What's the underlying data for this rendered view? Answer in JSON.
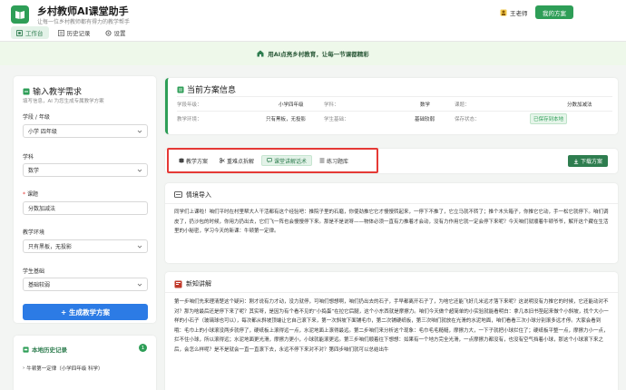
{
  "header": {
    "app_title": "乡村教师AI课堂助手",
    "app_subtitle": "让每一位乡村教师都有得力的教学帮手",
    "nav": [
      {
        "label": "工作台",
        "icon": "home-icon",
        "active": true
      },
      {
        "label": "历史记录",
        "icon": "history-icon",
        "active": false
      },
      {
        "label": "设置",
        "icon": "gear-icon",
        "active": false
      }
    ],
    "user_name": "王老师",
    "my_plan_button": "我的方案"
  },
  "banner": {
    "text": "用AI点亮乡村教育，让每一节课都精彩"
  },
  "left_panel": {
    "title": "输入教学需求",
    "subtitle": "填写信息，AI 为您生成专属教学方案",
    "fields": [
      {
        "label": "学段 / 年级",
        "value": "小学 四年级",
        "required": false
      },
      {
        "label": "学科",
        "value": "数学",
        "required": false
      },
      {
        "label": "课题",
        "value": "分数加减法",
        "required": true
      },
      {
        "label": "教学环境",
        "value": "只有黑板，无投影",
        "required": false
      },
      {
        "label": "学生基础",
        "value": "基础较弱",
        "required": false
      }
    ],
    "generate_button": "+ 生成教学方案"
  },
  "history": {
    "title": "本地历史记录",
    "count": "1",
    "items": [
      "牛顿第一定律（小学四年级 科学）"
    ]
  },
  "plan_info": {
    "title": "当前方案信息",
    "rows": [
      [
        {
          "k": "学段年级：",
          "v": "小学四年级"
        },
        {
          "k": "学科：",
          "v": "数学"
        },
        {
          "k": "课题：",
          "v": "分数加减法"
        }
      ],
      [
        {
          "k": "教学环境：",
          "v": "只有黑板，无投影"
        },
        {
          "k": "学生基础：",
          "v": "基础较弱"
        },
        {
          "k": "保存状态：",
          "v": "已保存到本地"
        }
      ]
    ]
  },
  "tabs": [
    {
      "label": "教学方案",
      "icon": "plan-icon",
      "active": false
    },
    {
      "label": "重难点拆解",
      "icon": "scissors-icon",
      "active": false
    },
    {
      "label": "课堂讲解话术",
      "icon": "speech-icon",
      "active": true
    },
    {
      "label": "练习题库",
      "icon": "list-icon",
      "active": false
    }
  ],
  "download_button": "下载方案",
  "sections": {
    "intro": {
      "title": "情境导入",
      "body": "同学们上课啦！咱们平时在村里帮大人干活都有这个经验吧：推院子里的石磨，你使劲推它它才慢慢转起来，一停下不推了，它立马就不转了；推个木头箱子，你推它它动，手一松它就停下。咱们调皮了，扔沙包的时候，你用力扔出去，它们飞一阵也会慢慢停下来。那是不是说呀——物体必须一直有力推着才会动，没有力作用它就一定会停下来呢？今天咱们就顺着牛顿爷爷，解开这个藏在生活里的小秘密，学习今天的新课：牛顿第一定律。"
    },
    "new": {
      "title": "新知讲解",
      "body": "第一步咱们先来理清楚这个疑问：刚才说有力才动，没力就停，可咱们想想啊，咱们扔出去的石子，手早都离开石子了，为啥它还能飞好几米远才落下来呢？这说明没有力推它的时候，它还能动对不对？那为啥最后还是停下来了呢？其实呀，是因为有个看不见的“小捣蛋”在拉它后腿，这个小东西就是摩擦力。咱们今天做个超简单的小实验就能看明白：拿几本旧书垫起来做个小斜坡，找个大小一样的小石子（玻璃球也可以），每次都从斜坡顶端让它自己滚下来，第一次斜坡下面铺毛巾，第二次铺硬纸板，第三次咱们就放在光滑的水泥地面，咱们看看三次小球分别滚多远才停。大家会看到哦：毛巾上的小球滚没两步就停了，硬纸板上滚得远一点，水泥地面上滚得最远。第二步咱们来分析这个现象：毛巾毛毛糙糙，摩擦力大，一下子就把小球拦住了；硬纸板平整一点，摩擦力小一点，拦不住小球，所以滚得远；水泥地面更光滑，摩擦力更小，小球就能滚更远。第三步咱们顺着往下想想：如果有一个地方完全光滑，一点摩擦力都没有，也没有空气挡着小球，那这个小球滚下来之后，会怎么样呢？是不是就会一直一直滚下去，永远不停下来对不对？第四步咱们就可以总结出牛"
    }
  }
}
